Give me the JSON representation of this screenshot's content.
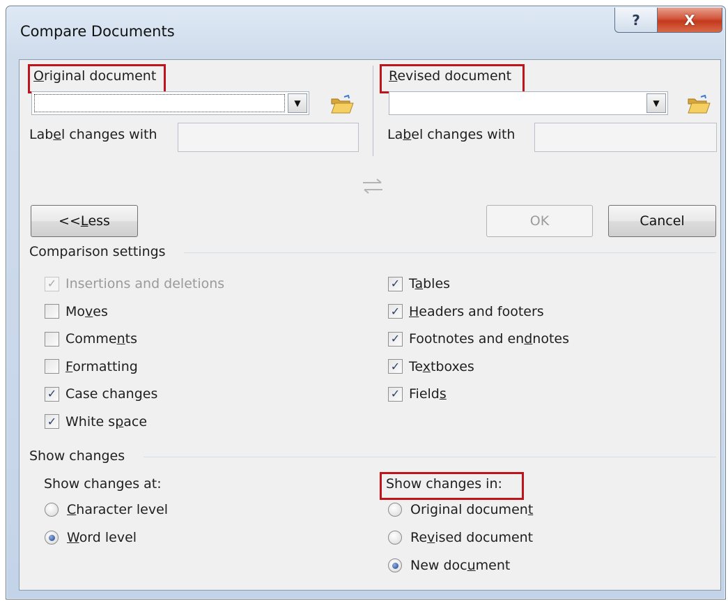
{
  "window": {
    "title": "Compare Documents",
    "help_glyph": "?",
    "close_glyph": "X"
  },
  "original": {
    "heading_pre": "",
    "heading_ul": "O",
    "heading_post": "riginal document",
    "value": "",
    "label_changes_pre": "Label ",
    "label_changes_ul": "g",
    "label_changes_post": "e changes with",
    "label_changes_fix": "La",
    "label_changes_tail": "bel chan",
    "label_value": ""
  },
  "revised": {
    "heading_ul": "R",
    "heading_post": "evised document",
    "value": "",
    "label_pre": "La",
    "label_ul": "b",
    "label_post": "el changes with",
    "label_value": ""
  },
  "buttons": {
    "less_pre": "<< ",
    "less_ul": "L",
    "less_post": "ess",
    "ok": "OK",
    "cancel": "Cancel"
  },
  "comparison": {
    "title": "Comparison settings",
    "left": [
      {
        "pre": "",
        "ul": "",
        "post": "Insertions and deletions",
        "checked": true,
        "disabled": true
      },
      {
        "pre": "Mo",
        "ul": "v",
        "post": "es",
        "checked": false,
        "disabled": false
      },
      {
        "pre": "Comme",
        "ul": "n",
        "post": "ts",
        "checked": false,
        "disabled": false
      },
      {
        "pre": "",
        "ul": "F",
        "post": "ormatting",
        "checked": false,
        "disabled": false
      },
      {
        "pre": "Case chan",
        "ul": "g",
        "post": "es",
        "checked": true,
        "disabled": false
      },
      {
        "pre": "White s",
        "ul": "p",
        "post": "ace",
        "checked": true,
        "disabled": false
      }
    ],
    "right": [
      {
        "pre": "T",
        "ul": "a",
        "post": "bles",
        "checked": true
      },
      {
        "pre": "",
        "ul": "H",
        "post": "eaders and footers",
        "checked": true
      },
      {
        "pre": "Footnotes and en",
        "ul": "d",
        "post": "notes",
        "checked": true
      },
      {
        "pre": "Te",
        "ul": "x",
        "post": "tboxes",
        "checked": true
      },
      {
        "pre": "Field",
        "ul": "s",
        "post": "",
        "checked": true
      }
    ]
  },
  "show_changes": {
    "title": "Show changes",
    "at_label": "Show changes at:",
    "at_options": [
      {
        "pre": "",
        "ul": "C",
        "post": "haracter level",
        "selected": false
      },
      {
        "pre": "",
        "ul": "W",
        "post": "ord level",
        "selected": true
      }
    ],
    "in_label": "Show changes in:",
    "in_options": [
      {
        "pre": "Original documen",
        "ul": "t",
        "post": "",
        "selected": false
      },
      {
        "pre": "Re",
        "ul": "v",
        "post": "ised document",
        "selected": false
      },
      {
        "pre": "New doc",
        "ul": "u",
        "post": "ment",
        "selected": true
      }
    ]
  },
  "colors": {
    "highlight_red": "#c0141c",
    "check_blue": "#2b3e66"
  },
  "icons": {
    "check": "✓",
    "dropdown": "▼"
  }
}
